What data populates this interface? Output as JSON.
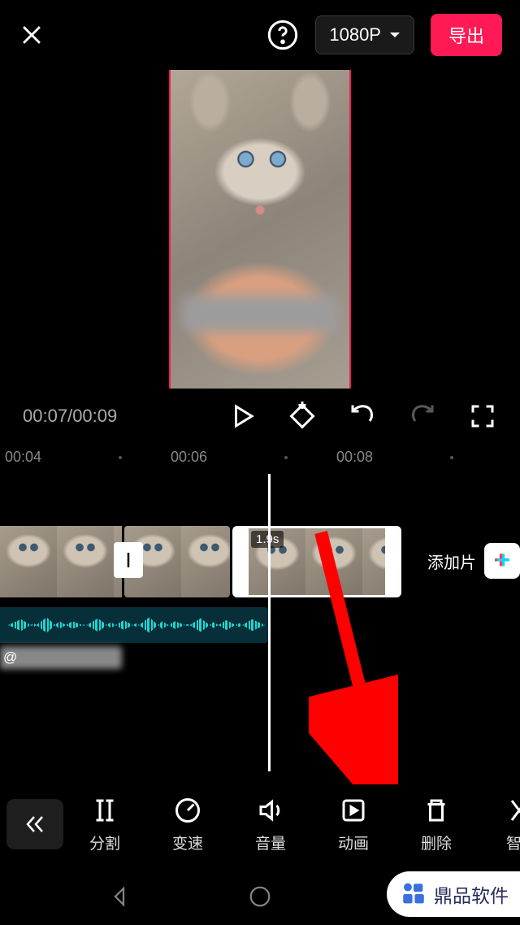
{
  "header": {
    "resolution": "1080P",
    "export": "导出"
  },
  "preview": {
    "time_current": "00:07",
    "time_total": "00:09"
  },
  "ruler": {
    "t1": "00:04",
    "t2": "00:06",
    "t3": "00:08"
  },
  "timeline": {
    "selected_duration": "1.9s",
    "add_scene": "添加片",
    "meta_prefix": "@"
  },
  "tools": {
    "split": "分割",
    "speed": "变速",
    "volume": "音量",
    "animation": "动画",
    "delete": "删除",
    "smart": "智能"
  },
  "watermark": "鼎品软件"
}
